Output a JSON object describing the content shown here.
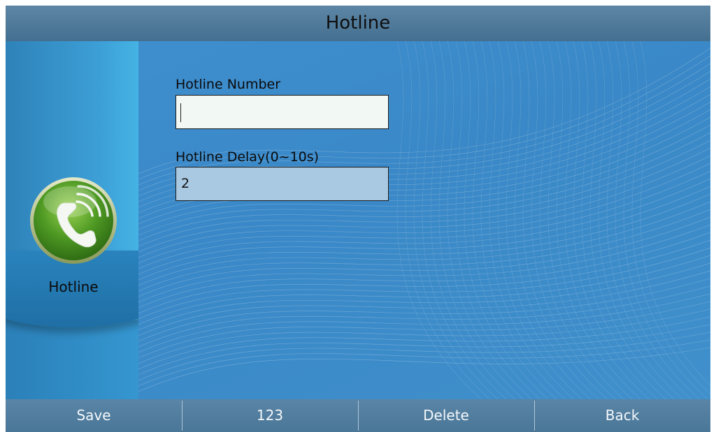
{
  "title": "Hotline",
  "side": {
    "label": "Hotline",
    "icon": "phone-handset-icon"
  },
  "form": {
    "number": {
      "label": "Hotline Number",
      "value": ""
    },
    "delay": {
      "label": "Hotline Delay(0~10s)",
      "value": "2"
    }
  },
  "softkeys": {
    "save": "Save",
    "input_mode": "123",
    "delete": "Delete",
    "back": "Back"
  },
  "colors": {
    "background": "#3d8bc8",
    "title_bar": "#4f7a9b",
    "softkey_bar": "#527e9f",
    "icon_green": "#5a9e2a"
  }
}
